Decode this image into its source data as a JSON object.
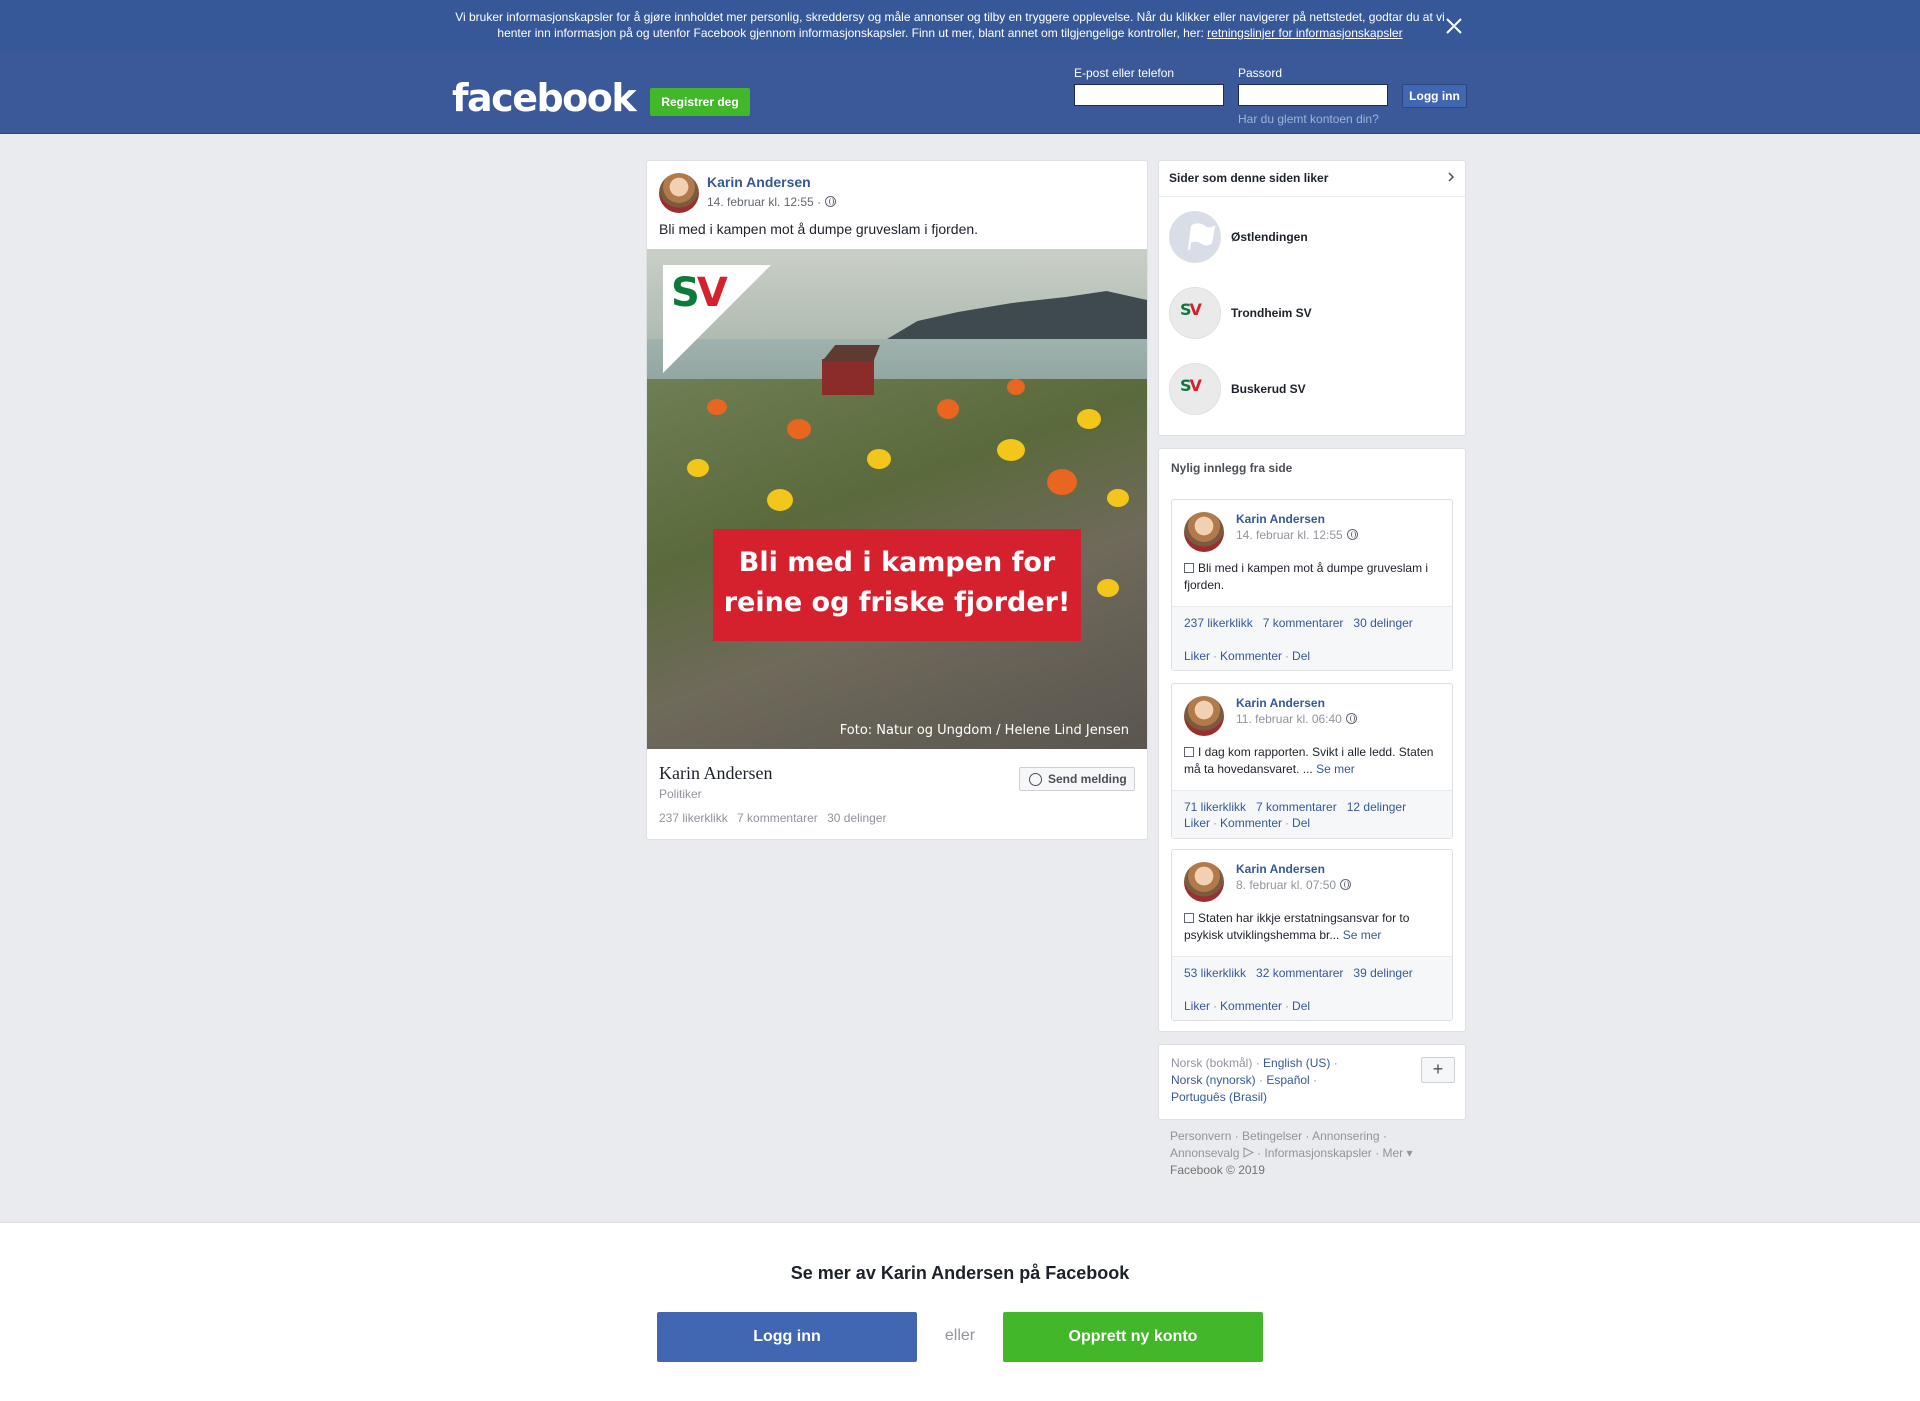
{
  "cookie": {
    "text": "Vi bruker informasjonskapsler for å gjøre innholdet mer personlig, skreddersy og måle annonser og tilby en tryggere opplevelse. Når du klikker eller navigerer på nettstedet, godtar du at vi henter inn informasjon på og utenfor Facebook gjennom informasjonskapsler. Finn ut mer, blant annet om tilgjengelige kontroller, her: ",
    "link": "retningslinjer for informasjonskapsler",
    "close_icon": "close-icon"
  },
  "header": {
    "logo": "facebook",
    "register": "Registrer deg",
    "email_label": "E-post eller telefon",
    "password_label": "Passord",
    "email_value": "",
    "password_value": "",
    "login": "Logg inn",
    "forgot": "Har du glemt kontoen din?"
  },
  "post": {
    "author": "Karin Andersen",
    "date": "14. februar kl. 12:55 ·",
    "text": "Bli med i kampen mot å dumpe gruveslam i fjorden.",
    "image": {
      "logo_s": "S",
      "logo_v": "V",
      "banner_line1": "Bli med i kampen for",
      "banner_line2": "reine og friske fjorder!",
      "credit": "Foto: Natur og Ungdom / Helene Lind Jensen"
    },
    "profile_name": "Karin Andersen",
    "role": "Politiker",
    "likes": "237 likerklikk",
    "comments": "7 kommentarer",
    "shares": "30 delinger",
    "send_message": "Send melding"
  },
  "pages_box": {
    "title": "Sider som denne siden liker",
    "pages": [
      {
        "name": "Østlendingen"
      },
      {
        "name": "Trondheim SV"
      },
      {
        "name": "Buskerud SV"
      }
    ]
  },
  "recent": {
    "title": "Nylig innlegg fra side",
    "posts": [
      {
        "author": "Karin Andersen",
        "date": "14. februar kl. 12:55",
        "text": "Bli med i kampen mot å dumpe gruveslam i fjorden.",
        "see_more": "",
        "likes": "237 likerklikk",
        "comments": "7 kommentarer",
        "shares": "30 delinger"
      },
      {
        "author": "Karin Andersen",
        "date": "11. februar kl. 06:40",
        "text": "I dag kom rapporten. Svikt i alle ledd. Staten må ta hovedansvaret. ...",
        "see_more": "Se mer",
        "likes": "71 likerklikk",
        "comments": "7 kommentarer",
        "shares": "12 delinger"
      },
      {
        "author": "Karin Andersen",
        "date": "8. februar kl. 07:50",
        "text": "Staten har ikkje erstatningsansvar for to psykisk utviklingshemma br...",
        "see_more": "Se mer",
        "likes": "53 likerklikk",
        "comments": "32 kommentarer",
        "shares": "39 delinger"
      }
    ],
    "actions": {
      "like": "Liker",
      "comment": "Kommenter",
      "share": "Del"
    }
  },
  "languages": {
    "current": "Norsk (bokmål)",
    "options": [
      "English (US)",
      "Norsk (nynorsk)",
      "Español",
      "Português (Brasil)"
    ],
    "more": "+"
  },
  "footer": {
    "links": [
      "Personvern",
      "Betingelser",
      "Annonsering",
      "Annonsevalg",
      "Informasjonskapsler",
      "Mer"
    ],
    "copyright": "Facebook © 2019"
  },
  "bottom": {
    "title": "Se mer av Karin Andersen på Facebook",
    "login": "Logg inn",
    "or": "eller",
    "create": "Opprett ny konto"
  },
  "colors": {
    "brand_blue": "#3b5998",
    "cookie_blue": "#365899",
    "green": "#42b72a",
    "sv_red": "#d5212e",
    "sv_green": "#0e7a3a"
  }
}
